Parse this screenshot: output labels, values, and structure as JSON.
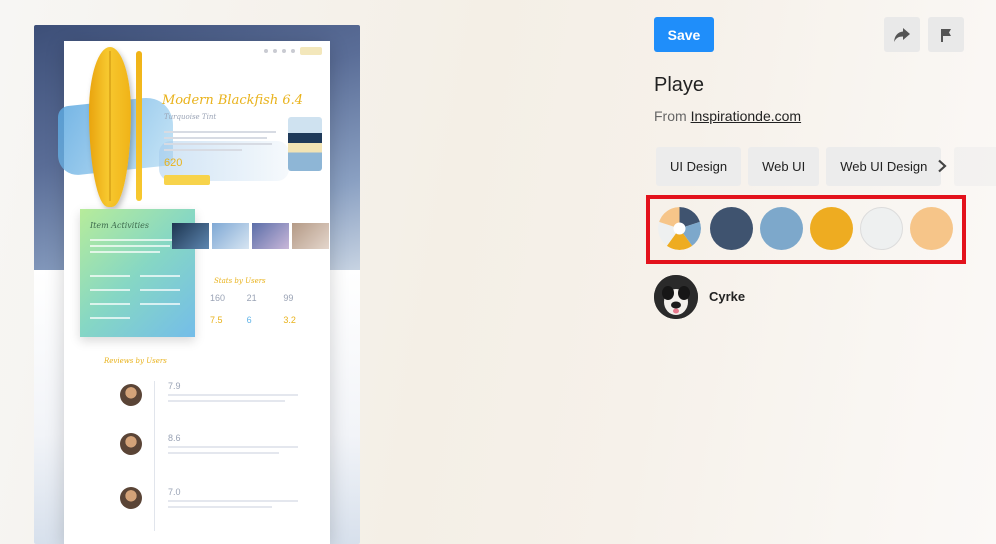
{
  "header": {
    "save_label": "Save",
    "share_icon": "share-arrow-icon",
    "report_icon": "flag-icon"
  },
  "pin": {
    "title": "Playe",
    "source_prefix": "From",
    "source_link": "Inspirationde.com",
    "mock": {
      "title": "Modern Blackfish 6.4",
      "subtitle": "Turquoise Tint",
      "price": "620",
      "section_title": "Item Activities",
      "stats_title": "Stats by Users",
      "reviews_title": "Reviews by Users",
      "stats": [
        "160",
        "21",
        "99",
        "7.5",
        "6",
        "3.2"
      ],
      "review_scores": [
        "7.9",
        "8.6",
        "7.0"
      ]
    }
  },
  "tags": {
    "items": [
      "UI Design",
      "Web UI",
      "Web UI Design"
    ],
    "next_icon": "chevron-right-icon"
  },
  "palette": {
    "swatches": [
      "multicolor",
      "#3f536f",
      "#7da8cb",
      "#eeac21",
      "#eef0f0",
      "#f6c589"
    ],
    "pie_colors": [
      "#3f536f",
      "#7da8cb",
      "#eeac21",
      "#eef0f0",
      "#f6c589"
    ],
    "highlight_color": "#e3121c"
  },
  "user": {
    "name": "Cyrke"
  },
  "colors": {
    "accent": "#1f8efa"
  }
}
